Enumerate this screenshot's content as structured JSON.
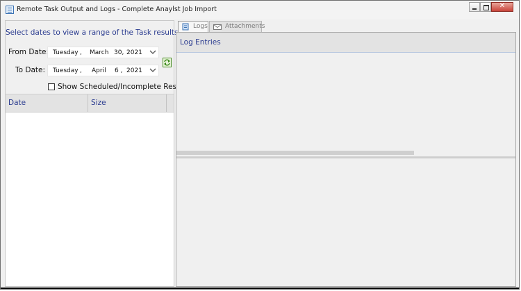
{
  "window": {
    "title": "Remote Task Output and Logs - Complete Anaylst Job Import"
  },
  "filter": {
    "heading": "Select dates to view a range of the Task results",
    "from_label": "From Date:",
    "to_label": "To Date:",
    "from_date": {
      "weekday": "Tuesday",
      "sep": ",",
      "month": "March",
      "day": "30,",
      "year": "2021"
    },
    "to_date": {
      "weekday": "Tuesday",
      "sep": ",",
      "month": "April",
      "day": "6 ,",
      "year": "2021"
    },
    "show_scheduled_label": "Show Scheduled/Incomplete Results",
    "show_scheduled_checked": false
  },
  "results_grid": {
    "columns": [
      "Date",
      "Size"
    ],
    "rows": []
  },
  "tabs": [
    {
      "label": "Logs",
      "icon": "scroll-icon",
      "active": true
    },
    {
      "label": "Attachments",
      "icon": "envelope-icon",
      "active": false
    }
  ],
  "logs": {
    "header": "Log Entries",
    "entries": []
  },
  "colors": {
    "accent_text": "#2a3b8f",
    "close_button": "#c9443a"
  }
}
